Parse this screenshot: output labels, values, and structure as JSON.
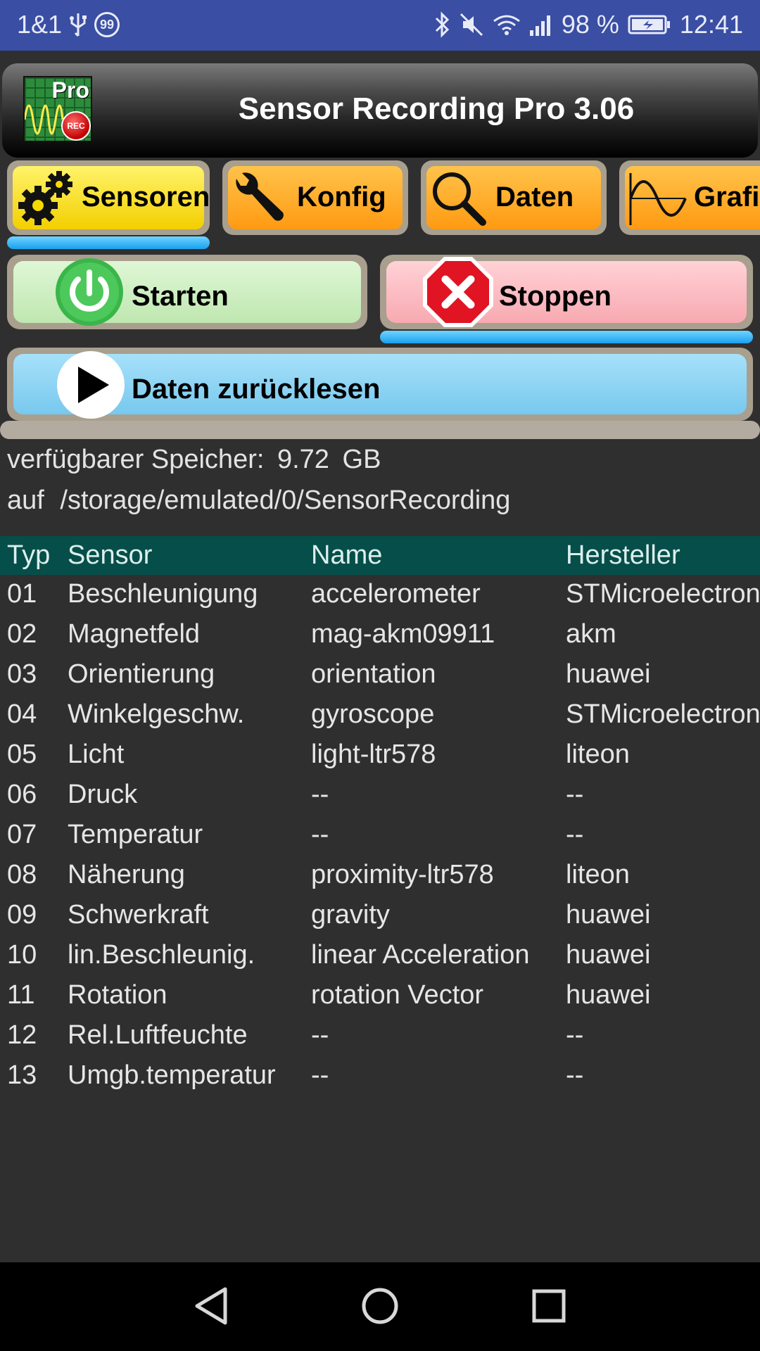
{
  "status_bar": {
    "carrier": "1&1",
    "badge_count": "99",
    "battery_percent": "98 %",
    "time": "12:41"
  },
  "app": {
    "title": "Sensor Recording Pro 3.06",
    "logo_badge": "Pro",
    "logo_rec": "REC"
  },
  "tabs": [
    {
      "label": "Sensoren",
      "icon": "gears-icon",
      "selected": true
    },
    {
      "label": "Konfig",
      "icon": "wrench-icon",
      "selected": false
    },
    {
      "label": "Daten",
      "icon": "magnifier-icon",
      "selected": false
    },
    {
      "label": "Grafi",
      "icon": "sine-wave-icon",
      "selected": false
    }
  ],
  "actions": {
    "start_label": "Starten",
    "stop_label": "Stoppen",
    "readback_label": "Daten zurücklesen"
  },
  "storage": {
    "available_label": "verfügbarer Speicher:",
    "available_value": "9.72",
    "available_unit": "GB",
    "location_prefix": "auf",
    "location_path": "/storage/emulated/0/SensorRecording"
  },
  "table": {
    "headers": {
      "typ": "Typ",
      "sensor": "Sensor",
      "name": "Name",
      "maker": "Hersteller"
    },
    "rows": [
      {
        "typ": "01",
        "sensor": "Beschleunigung",
        "name": "accelerometer",
        "maker": "STMicroelectronics"
      },
      {
        "typ": "02",
        "sensor": "Magnetfeld",
        "name": "mag-akm09911",
        "maker": "akm"
      },
      {
        "typ": "03",
        "sensor": "Orientierung",
        "name": "orientation",
        "maker": "huawei"
      },
      {
        "typ": "04",
        "sensor": "Winkelgeschw.",
        "name": "gyroscope",
        "maker": "STMicroelectronics"
      },
      {
        "typ": "05",
        "sensor": "Licht",
        "name": "light-ltr578",
        "maker": "liteon"
      },
      {
        "typ": "06",
        "sensor": "Druck",
        "name": "--",
        "maker": "--"
      },
      {
        "typ": "07",
        "sensor": "Temperatur",
        "name": "--",
        "maker": "--"
      },
      {
        "typ": "08",
        "sensor": "Näherung",
        "name": "proximity-ltr578",
        "maker": "liteon"
      },
      {
        "typ": "09",
        "sensor": "Schwerkraft",
        "name": "gravity",
        "maker": "huawei"
      },
      {
        "typ": "10",
        "sensor": "lin.Beschleunig.",
        "name": "linear Acceleration",
        "maker": "huawei"
      },
      {
        "typ": "11",
        "sensor": "Rotation",
        "name": "rotation Vector",
        "maker": "huawei"
      },
      {
        "typ": "12",
        "sensor": "Rel.Luftfeuchte",
        "name": "--",
        "maker": "--"
      },
      {
        "typ": "13",
        "sensor": "Umgb.temperatur",
        "name": "--",
        "maker": "--"
      }
    ]
  },
  "colors": {
    "status_bar": "#3a4ea3",
    "table_header": "#064e49",
    "background": "#2f2f2f",
    "start_button": "#cdeec0",
    "stop_button": "#fbb6bd",
    "readback_button": "#8ed3f4",
    "tab_selected": "#f7d900",
    "tab_normal": "#ffa41c",
    "indicator": "#1aa0ee"
  }
}
